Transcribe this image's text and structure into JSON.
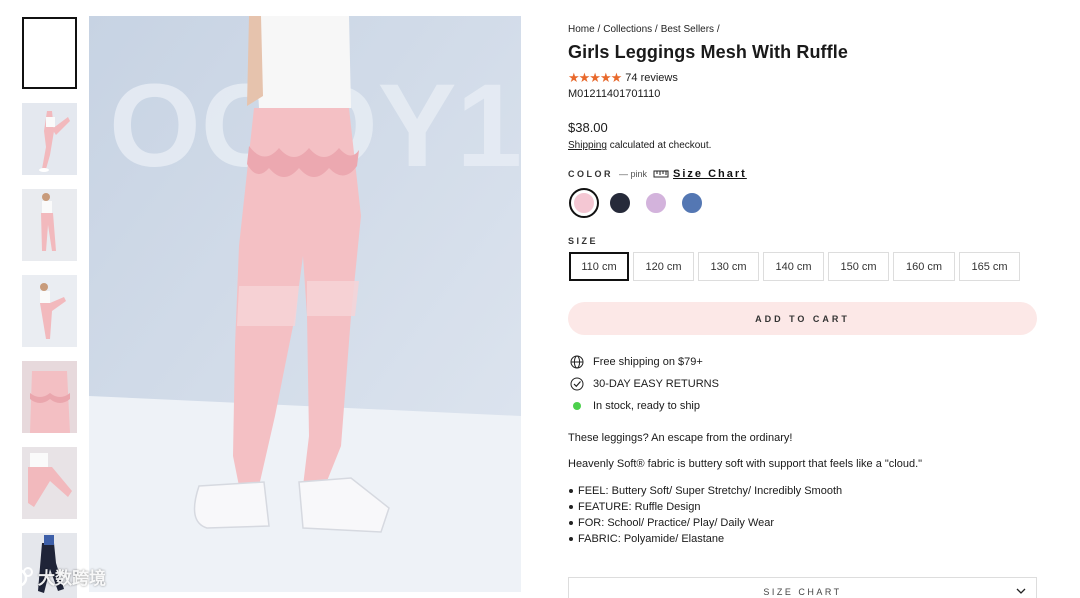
{
  "gallery": {
    "thumbnails": [
      {
        "name": "thumb-1",
        "pose": "blank",
        "active": true
      },
      {
        "name": "thumb-2",
        "pose": "stretch-leg"
      },
      {
        "name": "thumb-3",
        "pose": "standing"
      },
      {
        "name": "thumb-4",
        "pose": "kick"
      },
      {
        "name": "thumb-5",
        "pose": "ruffle-closeup"
      },
      {
        "name": "thumb-6",
        "pose": "kneel"
      },
      {
        "name": "thumb-7",
        "pose": "dark-outfit"
      }
    ],
    "backdrop_text": "OODY1"
  },
  "watermark": {
    "text": "大数跨境"
  },
  "breadcrumb": {
    "items": [
      "Home /",
      "Collections /",
      "Best Sellers /"
    ]
  },
  "product": {
    "title": "Girls Leggings Mesh With Ruffle",
    "stars": "★★★★★",
    "reviews": "74 reviews",
    "sku": "M01211401701110",
    "price": "$38.00",
    "shipping_link": "Shipping",
    "shipping_rest": " calculated at checkout."
  },
  "color": {
    "label": "COLOR",
    "selected_name": "— pink",
    "size_chart_link": "Size Chart",
    "swatches": [
      {
        "name": "pink",
        "hex": "#f4c7d3",
        "selected": true
      },
      {
        "name": "navy",
        "hex": "#262a3a"
      },
      {
        "name": "lavender",
        "hex": "#d3b3dc"
      },
      {
        "name": "blue",
        "hex": "#5477b3"
      }
    ]
  },
  "size": {
    "label": "SIZE",
    "options": [
      "110 cm",
      "120 cm",
      "130 cm",
      "140 cm",
      "150 cm",
      "160 cm",
      "165 cm"
    ],
    "selected_index": 0
  },
  "cart": {
    "label": "ADD TO CART",
    "bg": "#fce8e7"
  },
  "features": [
    {
      "icon": "globe-icon",
      "text": "Free shipping on $79+"
    },
    {
      "icon": "check-circle-icon",
      "text": "30-DAY EASY RETURNS"
    },
    {
      "icon": "in-stock-dot-icon",
      "text": "In stock, ready to ship",
      "color": "#4cd04c"
    }
  ],
  "description": {
    "intro": "These leggings? An escape from the ordinary!",
    "fabric": "Heavenly Soft® fabric is buttery soft with support that feels like a \"cloud.\"",
    "bullets": [
      "FEEL: Buttery Soft/ Super Stretchy/ Incredibly Smooth",
      "FEATURE: Ruffle Design",
      "FOR: School/ Practice/ Play/ Daily Wear",
      "FABRIC: Polyamide/ Elastane"
    ]
  },
  "accordion": {
    "label": "SIZE CHART"
  }
}
